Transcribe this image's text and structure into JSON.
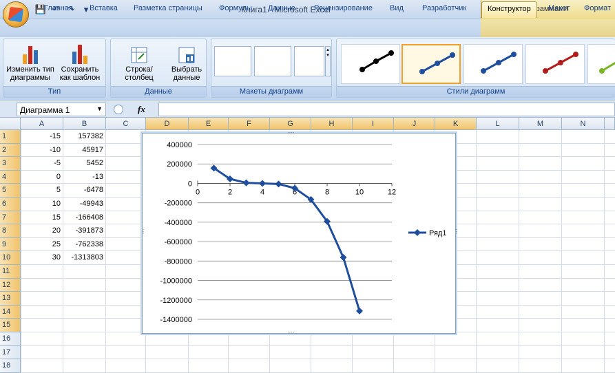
{
  "window": {
    "title": "Книга1 - Microsoft Excel",
    "context_title": "Работа с диаграммами"
  },
  "tabs": [
    {
      "label": "Главная"
    },
    {
      "label": "Вставка"
    },
    {
      "label": "Разметка страницы"
    },
    {
      "label": "Формулы"
    },
    {
      "label": "Данные"
    },
    {
      "label": "Рецензирование"
    },
    {
      "label": "Вид"
    },
    {
      "label": "Разработчик"
    },
    {
      "label": "Конструктор",
      "active": true
    },
    {
      "label": "Макет"
    },
    {
      "label": "Формат"
    }
  ],
  "ribbon": {
    "type_group": {
      "label": "Тип",
      "change_type": "Изменить тип диаграммы",
      "save_template": "Сохранить как шаблон"
    },
    "data_group": {
      "label": "Данные",
      "row_col": "Строка/столбец",
      "select_data": "Выбрать данные"
    },
    "layouts_group": {
      "label": "Макеты диаграмм"
    },
    "styles_group": {
      "label": "Стили диаграмм"
    },
    "style_colors": [
      "#000000",
      "#1f4e9c",
      "#1f4e9c",
      "#b11d1d",
      "#7ab526"
    ]
  },
  "formula_bar": {
    "name_box": "Диаграмма 1",
    "fx": "fx",
    "formula": ""
  },
  "grid": {
    "columns": [
      "A",
      "B",
      "C",
      "D",
      "E",
      "F",
      "G",
      "H",
      "I",
      "J",
      "K",
      "L",
      "M",
      "N"
    ],
    "rows": [
      "1",
      "2",
      "3",
      "4",
      "5",
      "6",
      "7",
      "8",
      "9",
      "10",
      "11",
      "12",
      "13",
      "14",
      "15",
      "16",
      "17",
      "18"
    ],
    "col_a": [
      "-15",
      "-10",
      "-5",
      "0",
      "5",
      "10",
      "15",
      "20",
      "25",
      "30"
    ],
    "col_b": [
      "157382",
      "45917",
      "5452",
      "-13",
      "-6478",
      "-49943",
      "-166408",
      "-391873",
      "-762338",
      "-1313803"
    ]
  },
  "chart_data": {
    "type": "line",
    "x": [
      1,
      2,
      3,
      4,
      5,
      6,
      7,
      8,
      9,
      10
    ],
    "series": [
      {
        "name": "Ряд1",
        "values": [
          157382,
          45917,
          5452,
          -13,
          -6478,
          -49943,
          -166408,
          -391873,
          -762338,
          -1313803
        ],
        "color": "#1f4e9c"
      }
    ],
    "x_ticks": [
      "0",
      "2",
      "4",
      "6",
      "8",
      "10",
      "12"
    ],
    "y_ticks": [
      "400000",
      "200000",
      "0",
      "-200000",
      "-400000",
      "-600000",
      "-800000",
      "-1000000",
      "-1200000",
      "-1400000"
    ],
    "xlim": [
      0,
      12
    ],
    "ylim": [
      -1400000,
      400000
    ],
    "grid": "horizontal",
    "legend": "right"
  }
}
